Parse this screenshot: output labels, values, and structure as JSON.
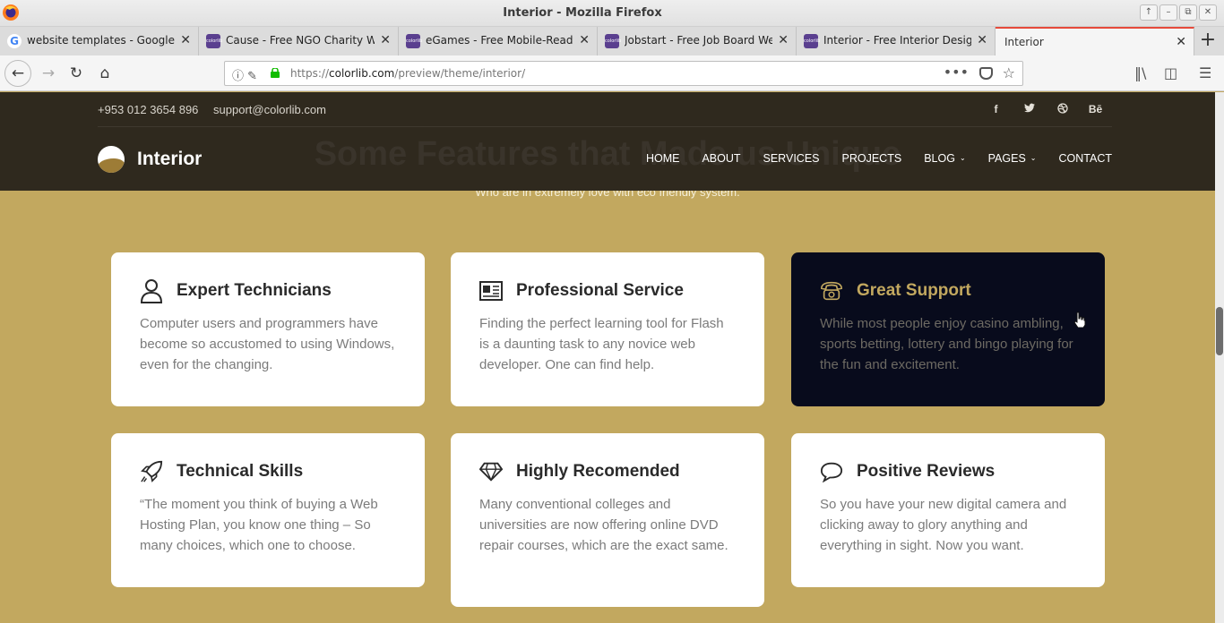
{
  "window": {
    "title": "Interior - Mozilla Firefox",
    "controls": [
      "↑",
      "–",
      "⧉",
      "✕"
    ]
  },
  "tabs": [
    {
      "label": "website templates - Google S",
      "favicon": "google-icon",
      "active": false
    },
    {
      "label": "Cause - Free NGO Charity We",
      "favicon": "colorlib-icon",
      "active": false
    },
    {
      "label": "eGames - Free Mobile-Ready",
      "favicon": "colorlib-icon",
      "active": false
    },
    {
      "label": "Jobstart - Free Job Board Web",
      "favicon": "colorlib-icon",
      "active": false
    },
    {
      "label": "Interior - Free Interior Design",
      "favicon": "colorlib-icon",
      "active": false
    },
    {
      "label": "Interior",
      "favicon": "",
      "active": true
    }
  ],
  "toolbar": {
    "url_prefix": "https://",
    "url_host": "colorlib.com",
    "url_path": "/preview/theme/interior/"
  },
  "site": {
    "phone": "+953 012 3654 896",
    "email": "support@colorlib.com",
    "socials": [
      "f",
      "t",
      "dribbble",
      "Bē"
    ],
    "logo_text": "Interior",
    "nav": [
      {
        "label": "HOME",
        "dropdown": false
      },
      {
        "label": "ABOUT",
        "dropdown": false
      },
      {
        "label": "SERVICES",
        "dropdown": false
      },
      {
        "label": "PROJECTS",
        "dropdown": false
      },
      {
        "label": "BLOG",
        "dropdown": true
      },
      {
        "label": "PAGES",
        "dropdown": true
      },
      {
        "label": "CONTACT",
        "dropdown": false
      }
    ],
    "section_title": "Some Features that Made us Unique",
    "section_subtitle": "Who are in extremely love with eco friendly system."
  },
  "features": [
    {
      "title": "Expert Technicians",
      "icon": "user-icon",
      "body": "Computer users and programmers have become so accustomed to using Windows, even for the changing.",
      "highlighted": false
    },
    {
      "title": "Professional Service",
      "icon": "license-icon",
      "body": "Finding the perfect learning tool for Flash is a daunting task to any novice web developer. One can find help.",
      "highlighted": false
    },
    {
      "title": "Great Support",
      "icon": "phone-icon",
      "body": "While most people enjoy casino ambling, sports betting, lottery and bingo playing for the fun and excitement.",
      "highlighted": true
    },
    {
      "title": "Technical Skills",
      "icon": "rocket-icon",
      "body": "“The moment you think of buying a Web Hosting Plan, you know one thing – So many choices, which one to choose.",
      "highlighted": false
    },
    {
      "title": "Highly Recomended",
      "icon": "diamond-icon",
      "body": "Many conventional colleges and universities are now offering online DVD repair courses, which are the exact same.",
      "highlighted": false
    },
    {
      "title": "Positive Reviews",
      "icon": "bubble-icon",
      "body": "So you have your new digital camera and clicking away to glory anything and everything in sight. Now you want.",
      "highlighted": false
    }
  ],
  "colors": {
    "accent": "#c2a85f",
    "header_bg": "#25211b",
    "highlight_card": "#080b1c"
  }
}
